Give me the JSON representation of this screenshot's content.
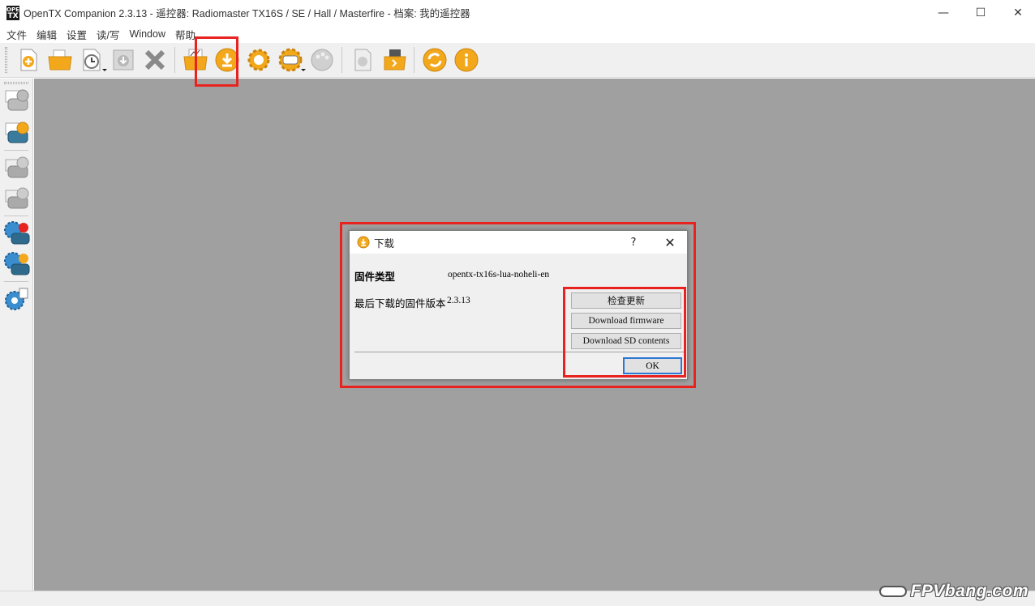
{
  "window": {
    "logo_top": "OPEN",
    "logo_bottom": "TX",
    "title": "OpenTX Companion 2.3.13 - 遥控器: Radiomaster TX16S / SE / Hall / Masterfire - 档案: 我的遥控器",
    "minimize": "—",
    "maximize": "☐",
    "close": "✕"
  },
  "menu": {
    "items": [
      "文件",
      "编辑",
      "设置",
      "读/写",
      "Window",
      "帮助"
    ]
  },
  "toolbar": {
    "icons": [
      "new-file-icon",
      "open-folder-icon",
      "recent-files-icon",
      "save-icon",
      "close-icon",
      "open-folder-chart-icon",
      "download-icon",
      "settings-gear-icon",
      "radio-profile-icon",
      "palette-icon",
      "simulate-icon",
      "sd-card-icon",
      "refresh-icon",
      "info-icon"
    ]
  },
  "dialog": {
    "title": "下载",
    "help": "?",
    "close": "✕",
    "firmware_type_label": "固件类型",
    "firmware_type_value": "opentx-tx16s-lua-noheli-en",
    "last_firmware_label": "最后下载的固件版本",
    "last_firmware_value": "2.3.13",
    "check_updates": "检查更新",
    "download_firmware": "Download firmware",
    "download_sd": "Download SD contents",
    "ok": "OK"
  },
  "watermark": {
    "text": "FPVbang.com"
  },
  "colors": {
    "highlight": "#e8231f",
    "accent_orange": "#f3a81c",
    "mdi_background": "#a0a0a0",
    "ok_border": "#2b78d4"
  }
}
